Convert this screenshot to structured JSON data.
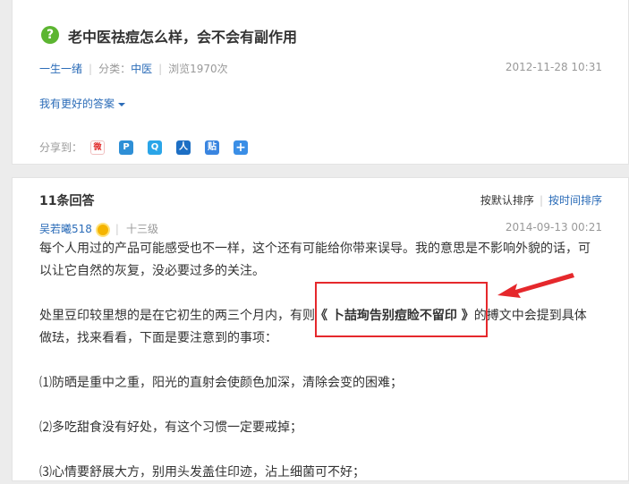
{
  "question": {
    "icon": "question-icon",
    "icon_glyph": "?",
    "title": "老中医祛痘怎么样，会不会有副作用",
    "user": "一生一绪",
    "category_label": "分类：",
    "category": "中医",
    "views": "浏览1970次",
    "date": "2012-11-28 10:31",
    "better_answer": "我有更好的答案",
    "share_label": "分享到："
  },
  "share_icons": [
    {
      "name": "weibo-icon",
      "glyph": "微",
      "color": "#ffffff"
    },
    {
      "name": "qzone-icon",
      "glyph": "P",
      "color": "#2e8fd6"
    },
    {
      "name": "qq-space-icon",
      "glyph": "Q",
      "color": "#2aa5e8"
    },
    {
      "name": "renren-icon",
      "glyph": "人",
      "color": "#1d6fc4"
    },
    {
      "name": "tieba-icon",
      "glyph": "贴",
      "color": "#3a85e0"
    },
    {
      "name": "more-share-icon",
      "glyph": "+",
      "color": "#3a8ee6"
    }
  ],
  "answers": {
    "count": "11条回答",
    "sort_default": "按默认排序",
    "sort_time": "按时间排序"
  },
  "answer": {
    "author": "吴若曦518",
    "level": "十三级",
    "date": "2014-09-13 00:21",
    "p1": "每个人用过的产品可能感受也不一样，这个还有可能给你带来误导。我的意思是不影响外貌的话，可以让它自然的灰复，没必要过多的关注。",
    "p2_before": "处里豆印较里想的是在它初生的两三个月内，有则",
    "p2_quote": "《 卜喆珣告别痘睑不留印 》",
    "p2_after": "的搏文中会提到具体做珐，找来看看，下面是要注意到的事项：",
    "p3": "⑴防晒是重中之重，阳光的直射会使颜色加深，清除会变的困难；",
    "p4": "⑵多吃甜食没有好处，有这个习惯一定要戒掉；",
    "p5": "⑶心情要舒展大方，别用头发盖住印迹，沾上细菌可不好；"
  },
  "colors": {
    "link": "#2b6cb8",
    "accent_green": "#5cb531",
    "annotation_red": "#e5282c"
  }
}
